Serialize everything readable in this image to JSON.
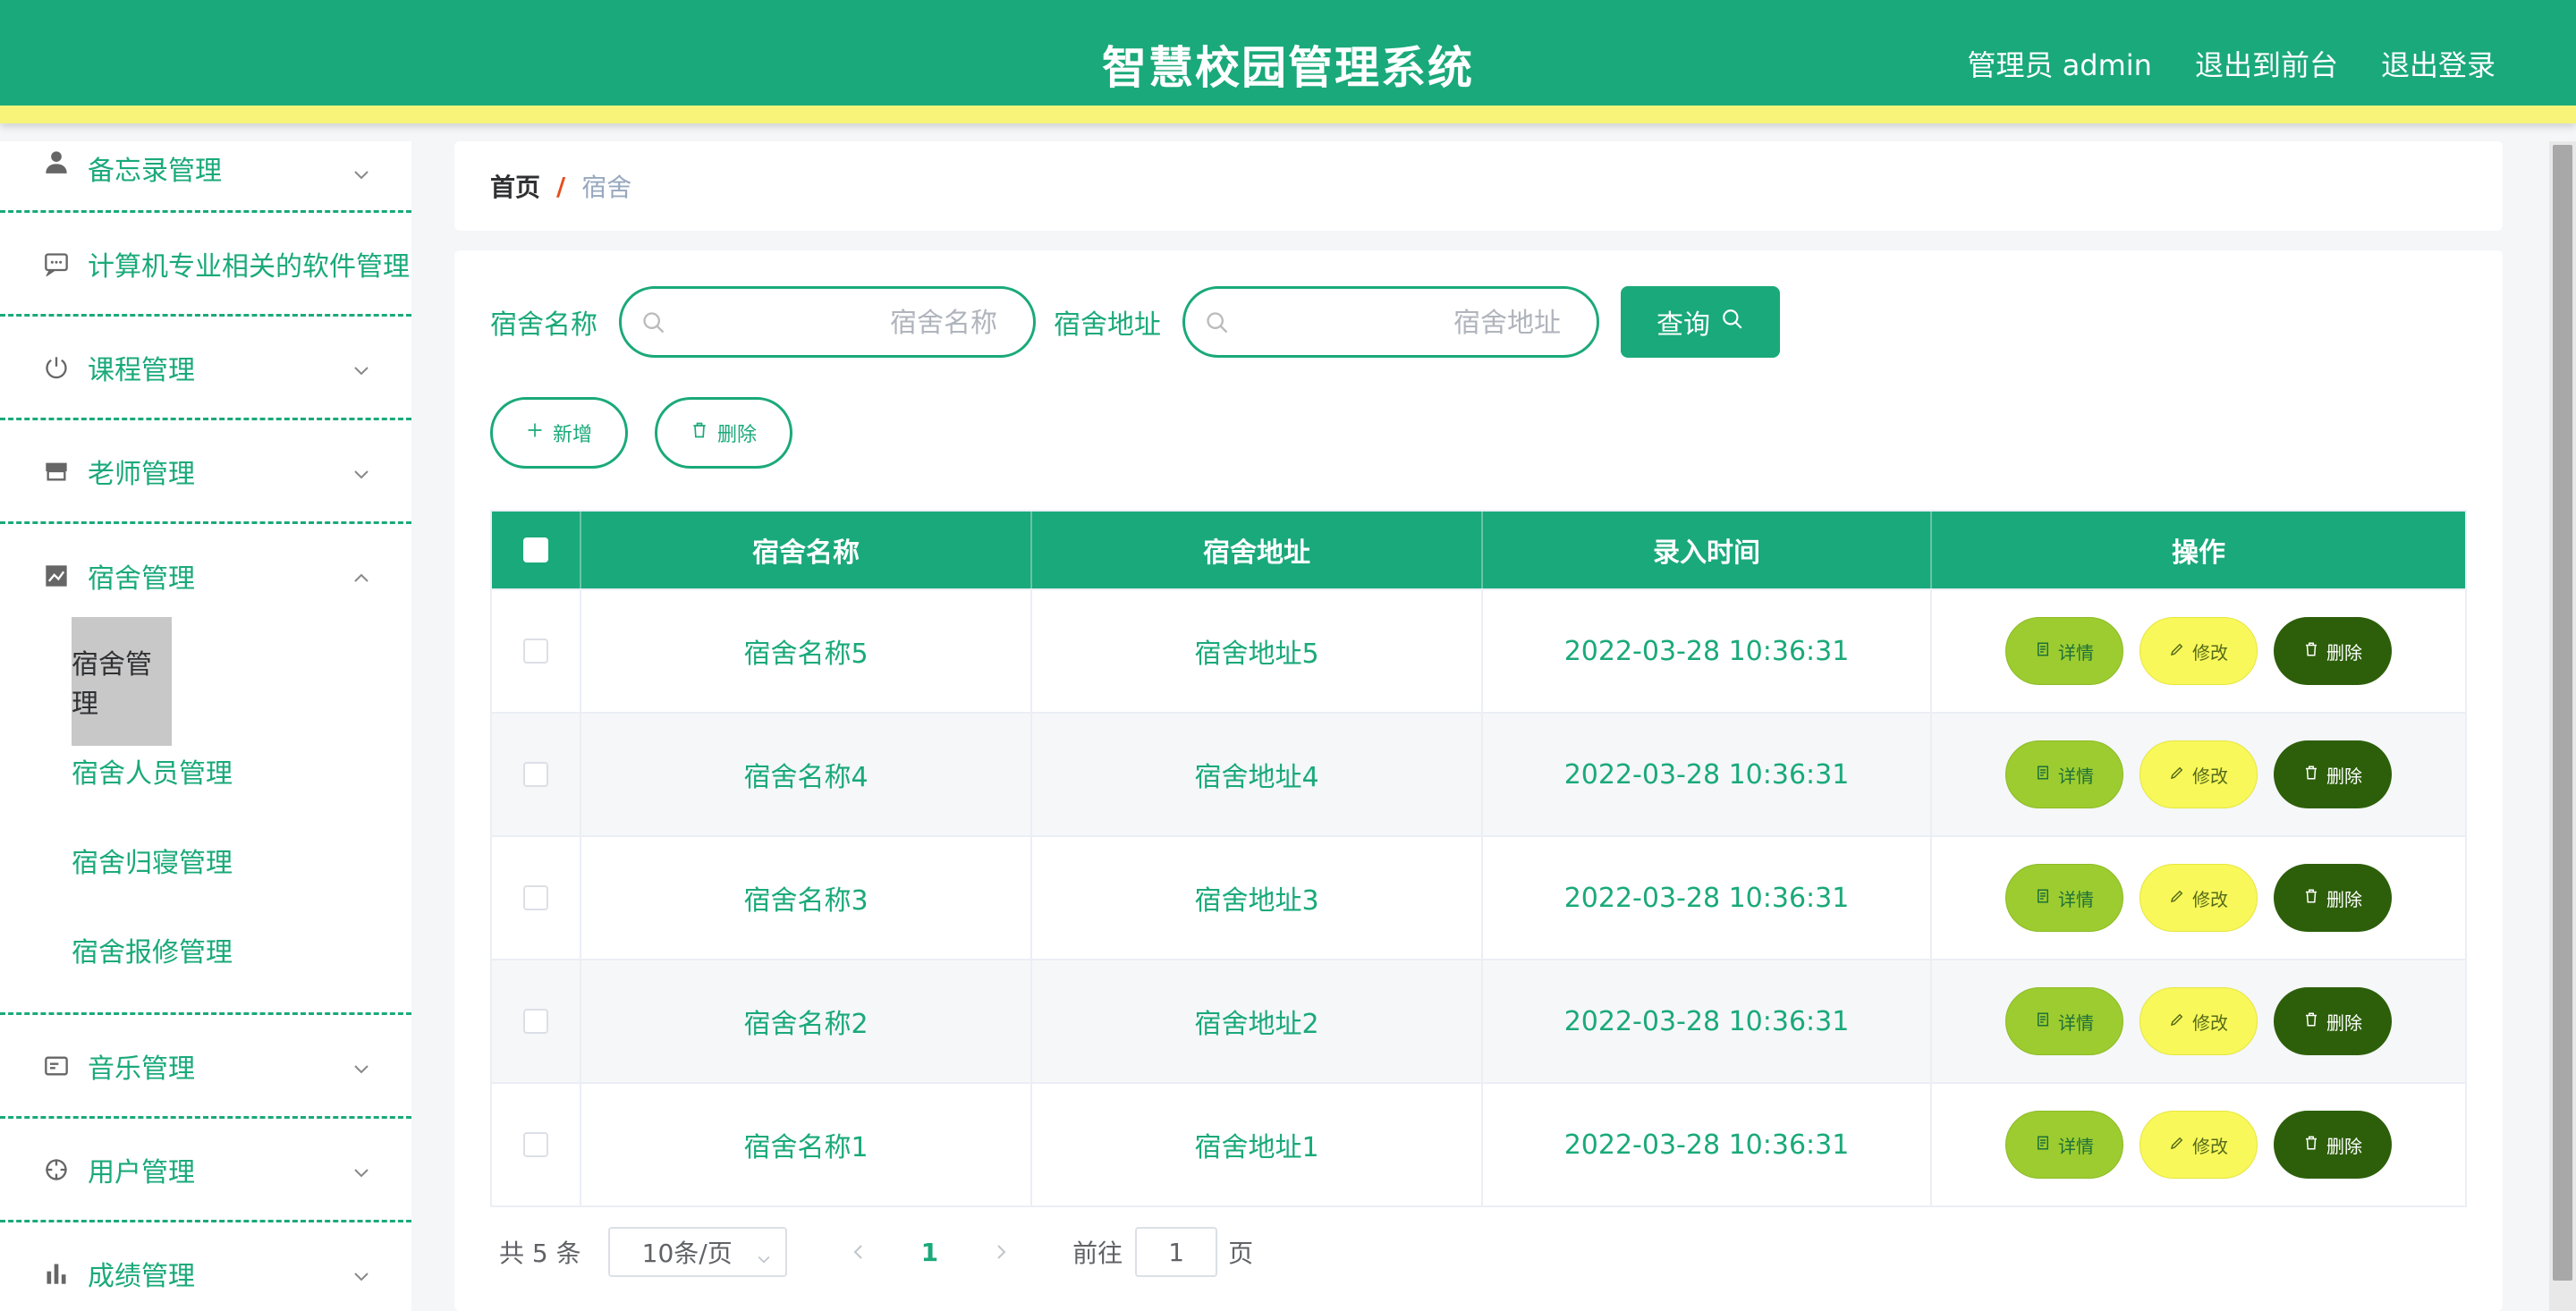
{
  "header": {
    "title": "智慧校园管理系统",
    "user_label": "管理员 admin",
    "front_label": "退出到前台",
    "logout_label": "退出登录"
  },
  "sidebar": {
    "items": [
      {
        "label": "备忘录管理",
        "icon": "user-icon"
      },
      {
        "label": "计算机专业相关的软件管理",
        "icon": "chat-icon"
      },
      {
        "label": "课程管理",
        "icon": "power-icon"
      },
      {
        "label": "老师管理",
        "icon": "shop-icon"
      },
      {
        "label": "宿舍管理",
        "icon": "chart-icon"
      },
      {
        "label": "音乐管理",
        "icon": "card-icon"
      },
      {
        "label": "用户管理",
        "icon": "aim-icon"
      },
      {
        "label": "成绩管理",
        "icon": "bar-chart-icon"
      }
    ],
    "submenu": [
      "宿舍管理",
      "宿舍人员管理",
      "宿舍归寝管理",
      "宿舍报修管理"
    ]
  },
  "breadcrumb": {
    "home": "首页",
    "separator": "/",
    "current": "宿舍"
  },
  "search": {
    "name_label": "宿舍名称",
    "name_placeholder": "宿舍名称",
    "addr_label": "宿舍地址",
    "addr_placeholder": "宿舍地址",
    "query_label": "查询"
  },
  "actions": {
    "add_label": "新增",
    "delete_label": "删除"
  },
  "table": {
    "columns": [
      "宿舍名称",
      "宿舍地址",
      "录入时间",
      "操作"
    ],
    "rows": [
      {
        "name": "宿舍名称5",
        "addr": "宿舍地址5",
        "time": "2022-03-28 10:36:31"
      },
      {
        "name": "宿舍名称4",
        "addr": "宿舍地址4",
        "time": "2022-03-28 10:36:31"
      },
      {
        "name": "宿舍名称3",
        "addr": "宿舍地址3",
        "time": "2022-03-28 10:36:31"
      },
      {
        "name": "宿舍名称2",
        "addr": "宿舍地址2",
        "time": "2022-03-28 10:36:31"
      },
      {
        "name": "宿舍名称1",
        "addr": "宿舍地址1",
        "time": "2022-03-28 10:36:31"
      }
    ],
    "ops": {
      "detail": "详情",
      "edit": "修改",
      "remove": "删除"
    }
  },
  "pager": {
    "total": "共 5 条",
    "page_size": "10条/页",
    "current_page": "1",
    "goto_prefix": "前往",
    "goto_value": "1",
    "goto_suffix": "页"
  },
  "colors": {
    "primary": "#1aa97a",
    "accent_strip": "#f8f47a",
    "detail_btn": "#9ccc2f",
    "edit_btn": "#f8f85a",
    "delete_btn": "#2d5f0a"
  }
}
